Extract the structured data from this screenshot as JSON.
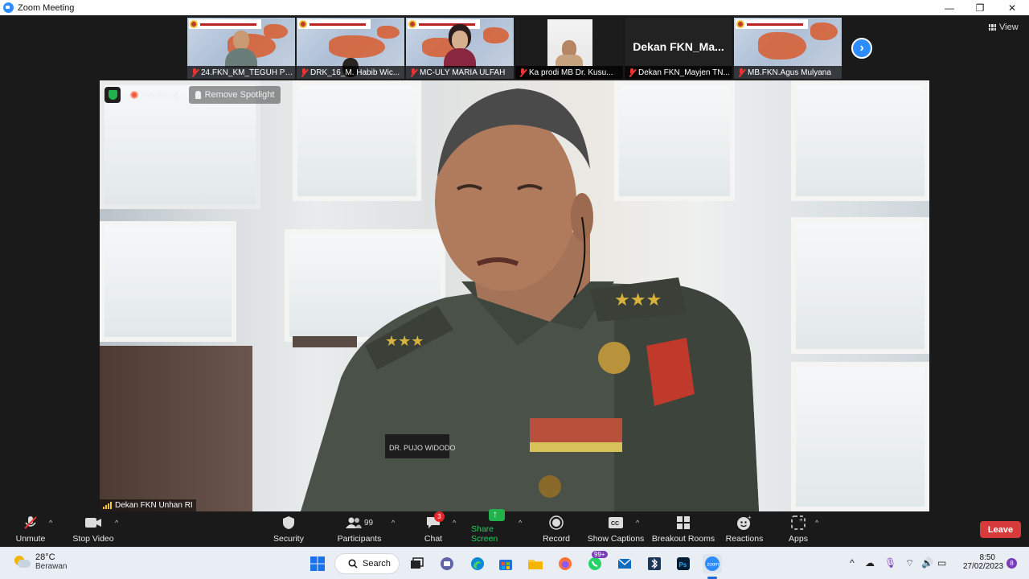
{
  "window": {
    "title": "Zoom Meeting",
    "controls": [
      "—",
      "❐",
      "✕"
    ]
  },
  "view_button": {
    "label": "View"
  },
  "thumbnails": [
    {
      "name": "24.FKN_KM_TEGUH PR...",
      "style": "map",
      "person": "male"
    },
    {
      "name": "DRK_16_M. Habib Wic...",
      "style": "map",
      "person": "male-partial"
    },
    {
      "name": "MC-ULY MARIA ULFAH",
      "style": "map",
      "person": "female"
    },
    {
      "name": "Ka prodi MB Dr. Kusu...",
      "style": "webcam",
      "person": "male"
    },
    {
      "name": "Dekan FKN_Mayjen TN...",
      "style": "dark",
      "display_name": "Dekan  FKN_Ma..."
    },
    {
      "name": "MB.FKN.Agus Mulyana",
      "style": "map",
      "person": "none"
    }
  ],
  "main_video": {
    "recording_label": "Recording",
    "spotlight_label": "Remove Spotlight",
    "speaker_name": "Dekan FKN Unhan RI",
    "name_tag": "DR. PUJO WIDODO"
  },
  "toolbar": {
    "unmute": "Unmute",
    "stop_video": "Stop Video",
    "security": "Security",
    "participants": "Participants",
    "participants_count": "99",
    "chat": "Chat",
    "chat_badge": "3",
    "share_screen": "Share Screen",
    "record": "Record",
    "show_captions": "Show Captions",
    "breakout_rooms": "Breakout Rooms",
    "reactions": "Reactions",
    "apps": "Apps",
    "leave": "Leave"
  },
  "taskbar": {
    "weather_temp": "28°C",
    "weather_desc": "Berawan",
    "search_label": "Search",
    "whatsapp_badge": "99+",
    "time": "8:50",
    "date": "27/02/2023",
    "notification_count": "8"
  },
  "colors": {
    "zoom_blue": "#2d8cff",
    "share_green": "#23b14d",
    "leave_red": "#d73a3a",
    "recording_orange": "#f05a3c"
  }
}
